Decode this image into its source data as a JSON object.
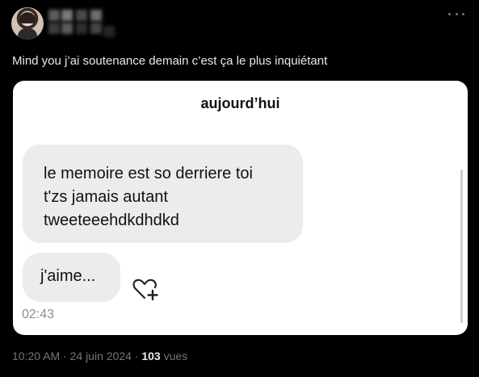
{
  "post": {
    "text": "Mind you j’ai soutenance demain c’est ça le plus inquiétant",
    "time": "10:20 AM",
    "separator": "·",
    "date": "24 juin 2024",
    "views_count": "103",
    "views_label": "vues"
  },
  "card": {
    "title": "aujourd’hui",
    "messages": [
      {
        "lines": [
          "le memoire est so derriere toi",
          "t'zs jamais autant",
          "tweeteeehdkdhdkd"
        ]
      },
      {
        "lines": [
          "j'aime..."
        ],
        "time": "02:43"
      }
    ]
  },
  "icons": {
    "more": "more-horizontal-icon",
    "react": "heart-plus-icon"
  }
}
